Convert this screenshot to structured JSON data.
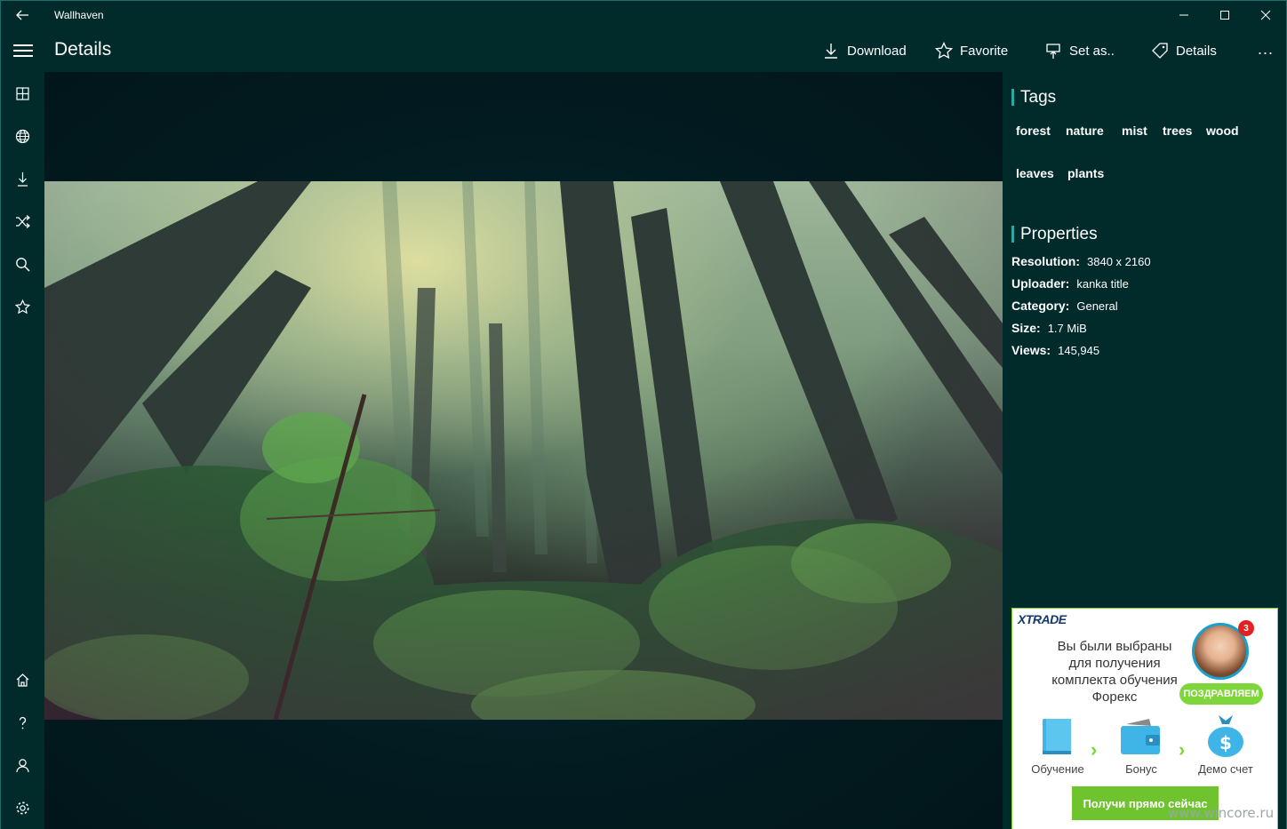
{
  "window": {
    "title": "Wallhaven"
  },
  "header": {
    "title": "Details",
    "commands": {
      "download": "Download",
      "favorite": "Favorite",
      "set_as": "Set as..",
      "details": "Details",
      "more": "..."
    }
  },
  "nav": {
    "items": [
      "grid-icon",
      "globe-icon",
      "download-icon",
      "shuffle-icon",
      "search-icon",
      "star-icon",
      "home-icon",
      "help-icon",
      "user-icon",
      "settings-icon"
    ]
  },
  "tags": {
    "heading": "Tags",
    "items": [
      "forest",
      "nature",
      "mist",
      "trees",
      "wood",
      "leaves",
      "plants"
    ]
  },
  "properties": {
    "heading": "Properties",
    "resolution": {
      "label": "Resolution:",
      "value": "3840 x 2160"
    },
    "uploader": {
      "label": "Uploader:",
      "value": "kanka title"
    },
    "category": {
      "label": "Category:",
      "value": "General"
    },
    "size": {
      "label": "Size:",
      "value": "1.7 MiB"
    },
    "views": {
      "label": "Views:",
      "value": "145,945"
    }
  },
  "ad": {
    "brand": "XTRADE",
    "text": "Вы были выбраны для получения комплекта обучения Форекс",
    "badge": "3",
    "congrats": "ПОЗДРАВЛЯЕМ",
    "step1": "Обучение",
    "step2": "Бонус",
    "step3": "Демо счет",
    "cta": "Получи прямо сейчас"
  },
  "watermark": "www.wincore.ru",
  "colors": {
    "background": "#012a2a",
    "accent": "#2aa9a2",
    "ad_green": "#7fd63a"
  }
}
